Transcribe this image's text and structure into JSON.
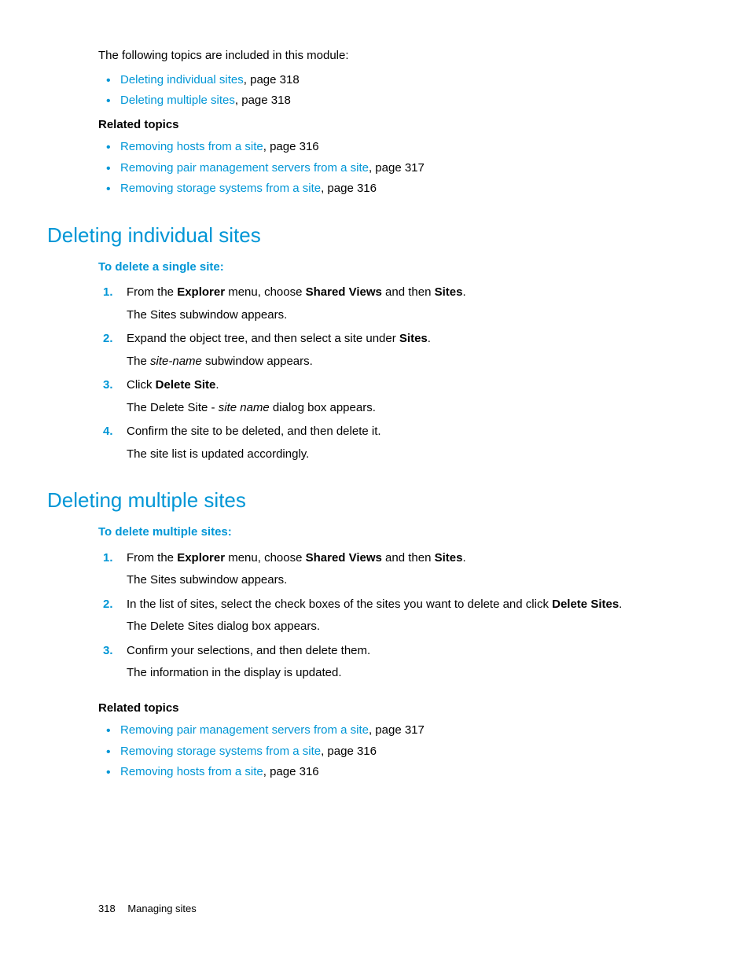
{
  "intro": "The following topics are included in this module:",
  "top_links": [
    {
      "text": "Deleting individual sites",
      "suffix": ", page 318"
    },
    {
      "text": "Deleting multiple sites",
      "suffix": ", page 318"
    }
  ],
  "related_heading": "Related topics",
  "related1": [
    {
      "text": "Removing hosts from a site",
      "suffix": ", page 316"
    },
    {
      "text": "Removing pair management servers from a site",
      "suffix": ", page 317"
    },
    {
      "text": "Removing storage systems from a site",
      "suffix": ", page 316"
    }
  ],
  "section1": {
    "title": "Deleting individual sites",
    "subhead": "To delete a single site:",
    "steps": [
      {
        "parts": [
          {
            "t": "plain",
            "v": "From the "
          },
          {
            "t": "bold",
            "v": "Explorer"
          },
          {
            "t": "plain",
            "v": " menu, choose "
          },
          {
            "t": "bold",
            "v": "Shared Views"
          },
          {
            "t": "plain",
            "v": " and then "
          },
          {
            "t": "bold",
            "v": "Sites"
          },
          {
            "t": "plain",
            "v": "."
          }
        ],
        "body": "The Sites subwindow appears."
      },
      {
        "parts": [
          {
            "t": "plain",
            "v": "Expand the object tree, and then select a site under "
          },
          {
            "t": "bold",
            "v": "Sites"
          },
          {
            "t": "plain",
            "v": "."
          }
        ],
        "body_parts": [
          {
            "t": "plain",
            "v": "The "
          },
          {
            "t": "ital",
            "v": "site-name"
          },
          {
            "t": "plain",
            "v": " subwindow appears."
          }
        ]
      },
      {
        "parts": [
          {
            "t": "plain",
            "v": "Click "
          },
          {
            "t": "bold",
            "v": "Delete Site"
          },
          {
            "t": "plain",
            "v": "."
          }
        ],
        "body_parts": [
          {
            "t": "plain",
            "v": "The Delete Site - "
          },
          {
            "t": "ital",
            "v": "site name"
          },
          {
            "t": "plain",
            "v": " dialog box appears."
          }
        ]
      },
      {
        "parts": [
          {
            "t": "plain",
            "v": "Confirm the site to be deleted, and then delete it."
          }
        ],
        "body": "The site list is updated accordingly."
      }
    ]
  },
  "section2": {
    "title": "Deleting multiple sites",
    "subhead": "To delete multiple sites:",
    "steps": [
      {
        "parts": [
          {
            "t": "plain",
            "v": "From the "
          },
          {
            "t": "bold",
            "v": "Explorer"
          },
          {
            "t": "plain",
            "v": " menu, choose "
          },
          {
            "t": "bold",
            "v": "Shared Views"
          },
          {
            "t": "plain",
            "v": " and then "
          },
          {
            "t": "bold",
            "v": "Sites"
          },
          {
            "t": "plain",
            "v": "."
          }
        ],
        "body": "The Sites subwindow appears."
      },
      {
        "parts": [
          {
            "t": "plain",
            "v": "In the list of sites, select the check boxes of the sites you want to delete and click "
          },
          {
            "t": "bold",
            "v": "Delete Sites"
          },
          {
            "t": "plain",
            "v": "."
          }
        ],
        "body": "The Delete Sites dialog box appears."
      },
      {
        "parts": [
          {
            "t": "plain",
            "v": "Confirm your selections, and then delete them."
          }
        ],
        "body": "The information in the display is updated."
      }
    ]
  },
  "related2": [
    {
      "text": "Removing pair management servers from a site",
      "suffix": ", page 317"
    },
    {
      "text": "Removing storage systems from a site",
      "suffix": ", page 316"
    },
    {
      "text": "Removing hosts from a site",
      "suffix": ", page 316"
    }
  ],
  "footer": {
    "page": "318",
    "chapter": "Managing sites"
  }
}
